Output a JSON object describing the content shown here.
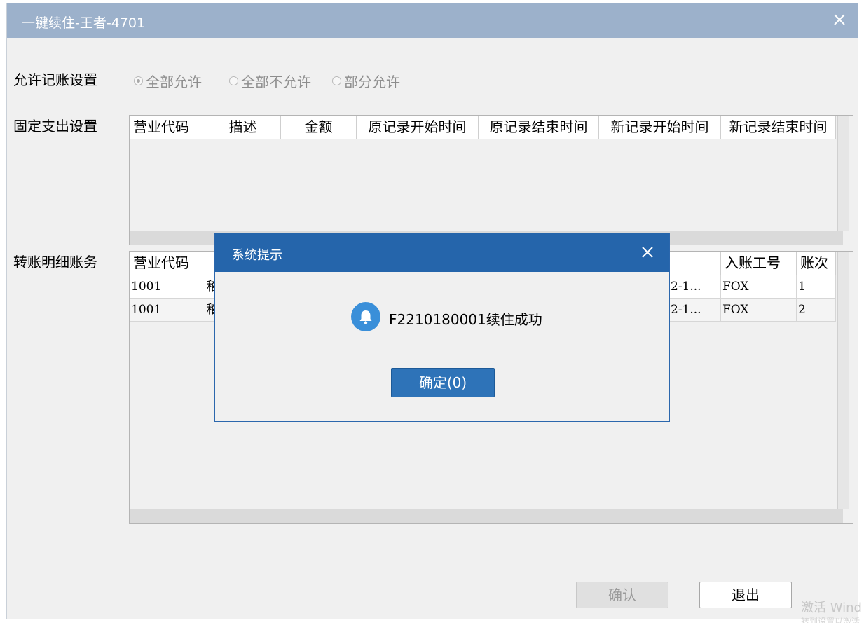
{
  "window": {
    "title": "一键续住-王者-4701"
  },
  "settings": {
    "allow_label": "允许记账设置",
    "radio_all_allow": "全部允许",
    "radio_all_deny": "全部不允许",
    "radio_partial": "部分允许",
    "selected": "全部允许",
    "fixed_label": "固定支出设置",
    "transfer_label": "转账明细账务"
  },
  "fixed_table": {
    "columns": [
      "营业代码",
      "描述",
      "金额",
      "原记录开始时间",
      "原记录结束时间",
      "新记录开始时间",
      "新记录结束时间"
    ]
  },
  "transfer_table": {
    "columns": [
      "营业代码",
      "入账工号",
      "账次"
    ],
    "rows": [
      {
        "code": "1001",
        "desc": "稽",
        "time": "2-1...",
        "staff": "FOX",
        "seq": "1"
      },
      {
        "code": "1001",
        "desc": "稽",
        "time": "2-1...",
        "staff": "FOX",
        "seq": "2"
      }
    ]
  },
  "buttons": {
    "confirm": "确认",
    "exit": "退出"
  },
  "dialog": {
    "title": "系统提示",
    "message": "F2210180001续住成功",
    "ok_label": "确定(0)"
  },
  "watermark": {
    "line1": "激活 Wind",
    "line2": "转到设置以激活"
  },
  "icons": {
    "close": "close-icon",
    "bell": "bell-icon"
  },
  "colors": {
    "title_bar": "#9cb1cb",
    "dialog_header": "#2565ab",
    "ok_button": "#2e73b8"
  }
}
